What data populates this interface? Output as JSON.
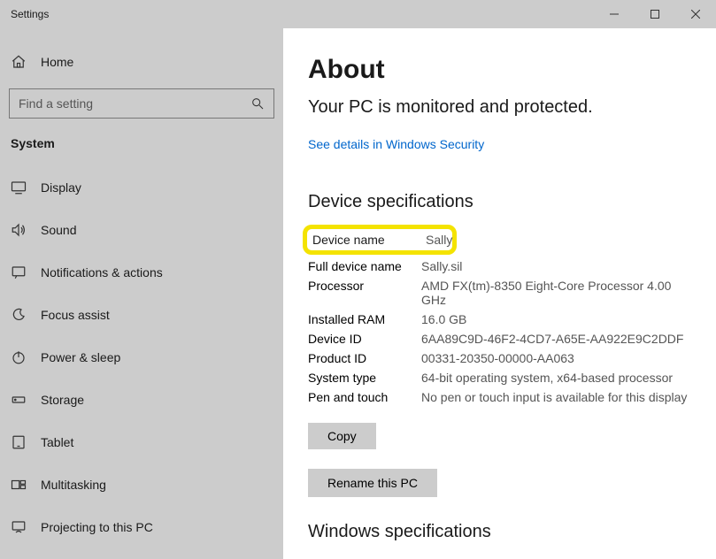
{
  "window": {
    "title": "Settings"
  },
  "sidebar": {
    "home_label": "Home",
    "search_placeholder": "Find a setting",
    "section_label": "System",
    "items": [
      {
        "label": "Display"
      },
      {
        "label": "Sound"
      },
      {
        "label": "Notifications & actions"
      },
      {
        "label": "Focus assist"
      },
      {
        "label": "Power & sleep"
      },
      {
        "label": "Storage"
      },
      {
        "label": "Tablet"
      },
      {
        "label": "Multitasking"
      },
      {
        "label": "Projecting to this PC"
      }
    ]
  },
  "main": {
    "heading": "About",
    "status": "Your PC is monitored and protected.",
    "security_link": "See details in Windows Security",
    "device_spec_heading": "Device specifications",
    "specs": {
      "device_name_k": "Device name",
      "device_name_v": "Sally",
      "full_device_name_k": "Full device name",
      "full_device_name_v": "Sally.sil",
      "processor_k": "Processor",
      "processor_v": "AMD FX(tm)-8350 Eight-Core Processor 4.00 GHz",
      "ram_k": "Installed RAM",
      "ram_v": "16.0 GB",
      "device_id_k": "Device ID",
      "device_id_v": "6AA89C9D-46F2-4CD7-A65E-AA922E9C2DDF",
      "product_id_k": "Product ID",
      "product_id_v": "00331-20350-00000-AA063",
      "system_type_k": "System type",
      "system_type_v": "64-bit operating system, x64-based processor",
      "pen_touch_k": "Pen and touch",
      "pen_touch_v": "No pen or touch input is available for this display"
    },
    "copy_label": "Copy",
    "rename_label": "Rename this PC",
    "win_spec_heading": "Windows specifications"
  }
}
